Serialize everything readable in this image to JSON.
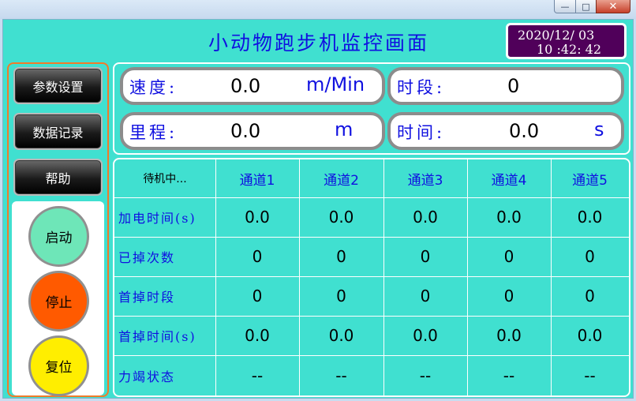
{
  "window": {
    "min_glyph": "—",
    "max_glyph": "□",
    "close_glyph": "✕"
  },
  "header": {
    "title": "小动物跑步机监控画面",
    "date": "2020/12/ 03",
    "time": "10 :42: 42"
  },
  "nav": {
    "params": "参数设置",
    "records": "数据记录",
    "help": "帮助"
  },
  "controls": {
    "start": "启动",
    "stop": "停止",
    "reset": "复位",
    "colors": {
      "start": "#6ee6b8",
      "stop": "#ff5a00",
      "reset": "#ffee00"
    }
  },
  "info": {
    "speed_label": "速度:",
    "speed_value": "0.0",
    "speed_unit": "m/Min",
    "period_label": "时段:",
    "period_value": "0",
    "distance_label": "里程:",
    "distance_value": "0.0",
    "distance_unit": "m",
    "time_label": "时间:",
    "time_value": "0.0",
    "time_unit": "s"
  },
  "table": {
    "status": "待机中...",
    "channels": [
      "通道1",
      "通道2",
      "通道3",
      "通道4",
      "通道5"
    ],
    "rows": [
      {
        "label": "加电时间(s)",
        "values": [
          "0.0",
          "0.0",
          "0.0",
          "0.0",
          "0.0"
        ]
      },
      {
        "label": "已掉次数",
        "values": [
          "0",
          "0",
          "0",
          "0",
          "0"
        ]
      },
      {
        "label": "首掉时段",
        "values": [
          "0",
          "0",
          "0",
          "0",
          "0"
        ]
      },
      {
        "label": "首掉时间(s)",
        "values": [
          "0.0",
          "0.0",
          "0.0",
          "0.0",
          "0.0"
        ]
      },
      {
        "label": "力竭状态",
        "values": [
          "--",
          "--",
          "--",
          "--",
          "--"
        ]
      }
    ]
  }
}
